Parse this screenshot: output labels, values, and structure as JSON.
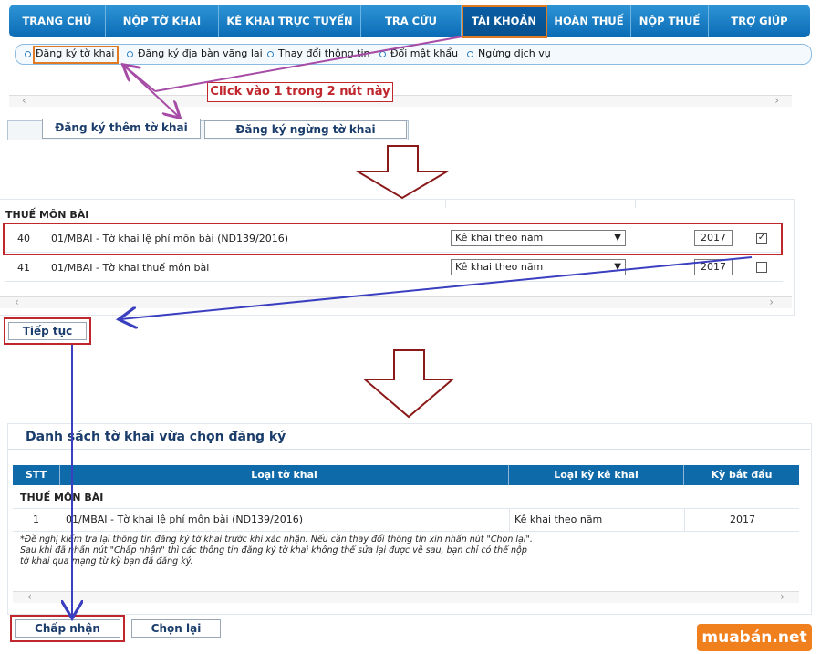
{
  "nav": [
    {
      "label": "TRANG CHỦ"
    },
    {
      "label": "NỘP TỜ KHAI"
    },
    {
      "label": "KÊ KHAI TRỰC TUYẾN"
    },
    {
      "label": "TRA CỨU"
    },
    {
      "label": "TÀI KHOẢN"
    },
    {
      "label": "HOÀN THUẾ"
    },
    {
      "label": "NỘP THUẾ"
    },
    {
      "label": "TRỢ GIÚP"
    }
  ],
  "subnav": [
    {
      "label": "Đăng ký tờ khai"
    },
    {
      "label": "Đăng ký địa bàn vãng lai"
    },
    {
      "label": "Thay đổi thông tin"
    },
    {
      "label": "Đổi mật khẩu"
    },
    {
      "label": "Ngừng dịch vụ"
    }
  ],
  "annotation": "Click vào 1 trong 2 nút này",
  "tabs": {
    "add": "Đăng ký thêm tờ khai",
    "stop": "Đăng ký ngừng tờ khai"
  },
  "section_title": "THUẾ MÔN BÀI",
  "rows": [
    {
      "no": "40",
      "name": "01/MBAI - Tờ khai lệ phí môn bài (ND139/2016)",
      "period": "Kê khai theo năm",
      "year": "2017",
      "checked": "✓"
    },
    {
      "no": "41",
      "name": "01/MBAI - Tờ khai thuế môn bài",
      "period": "Kê khai theo năm",
      "year": "2017",
      "checked": ""
    }
  ],
  "continue_label": "Tiếp tục",
  "selected": {
    "title": "Danh sách tờ khai vừa chọn đăng ký",
    "headers": [
      "STT",
      "Loại tờ khai",
      "Loại kỳ kê khai",
      "Kỳ bắt đầu"
    ],
    "group": "THUẾ MÔN BÀI",
    "row": {
      "stt": "1",
      "name": "01/MBAI - Tờ khai lệ phí môn bài (ND139/2016)",
      "period": "Kê khai theo năm",
      "start": "2017"
    },
    "note": [
      "*Đề nghị kiểm tra lại thông tin đăng ký tờ khai trước khi xác nhận. Nếu cần thay đổi thông tin xin nhấn nút \"Chọn lại\".",
      "Sau khi đã nhấn nút \"Chấp nhận\" thì các thông tin đăng ký tờ khai không thể sửa lại được về sau, bạn chỉ có thể nộp",
      "tờ khai qua mạng từ kỳ bạn đã đăng ký."
    ]
  },
  "accept_label": "Chấp nhận",
  "reselect_label": "Chọn lại",
  "logo": "muabán.net",
  "colors": {
    "accent": "#0a6bb5",
    "annotation_red": "#c0272d",
    "annotation_orange": "#e07b24",
    "arrow_purple": "#a64ca6",
    "arrow_blue": "#3a3fbf",
    "flow_arrow": "#8a1a1a"
  }
}
